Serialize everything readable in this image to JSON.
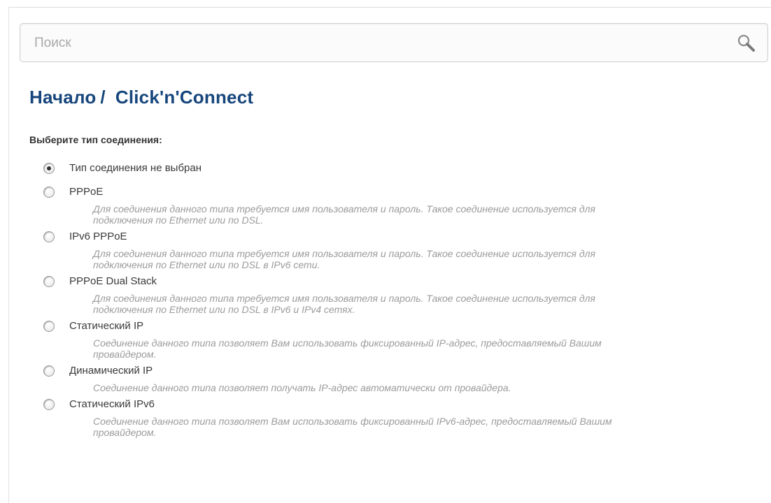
{
  "search": {
    "placeholder": "Поиск"
  },
  "breadcrumb": {
    "home": "Начало",
    "separator": "/",
    "current": "Click'n'Connect"
  },
  "connection": {
    "prompt": "Выберите тип соединения:",
    "selected_index": 0,
    "options": [
      {
        "label": "Тип соединения не выбран",
        "description": ""
      },
      {
        "label": "PPPoE",
        "description": "Для соединения данного типа требуется имя пользователя и пароль. Такое соединение используется для подключения по Ethernet или по DSL."
      },
      {
        "label": "IPv6 PPPoE",
        "description": "Для соединения данного типа требуется имя пользователя и пароль. Такое соединение используется для подключения по Ethernet или по DSL в IPv6 сети."
      },
      {
        "label": "PPPoE Dual Stack",
        "description": "Для соединения данного типа требуется имя пользователя и пароль. Такое соединение используется для подключения по Ethernet или по DSL в IPv6 и IPv4 сетях."
      },
      {
        "label": "Статический IP",
        "description": "Соединение данного типа позволяет Вам использовать фиксированный IP-адрес, предоставляемый Вашим провайдером."
      },
      {
        "label": "Динамический IP",
        "description": "Соединение данного типа позволяет получать IP-адрес автоматически от провайдера."
      },
      {
        "label": "Статический IPv6",
        "description": "Соединение данного типа позволяет Вам использовать фиксированный IPv6-адрес, предоставляемый Вашим провайдером."
      }
    ]
  },
  "colors": {
    "title": "#17467c",
    "description": "#9b9b9b",
    "label": "#3a3a3a"
  },
  "icons": {
    "search": "search-icon"
  }
}
